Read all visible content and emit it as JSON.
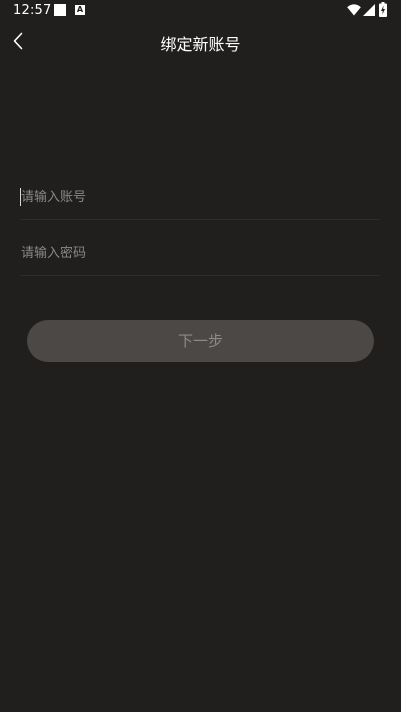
{
  "status_bar": {
    "time": "12:57",
    "notification_letter": "A"
  },
  "header": {
    "title": "绑定新账号"
  },
  "form": {
    "account": {
      "placeholder": "请输入账号",
      "value": ""
    },
    "password": {
      "placeholder": "请输入密码",
      "value": ""
    },
    "next_label": "下一步"
  },
  "colors": {
    "background": "#211f1e",
    "button_bg": "#4b4846",
    "button_text": "#8d8a88",
    "placeholder": "#8a8786"
  }
}
